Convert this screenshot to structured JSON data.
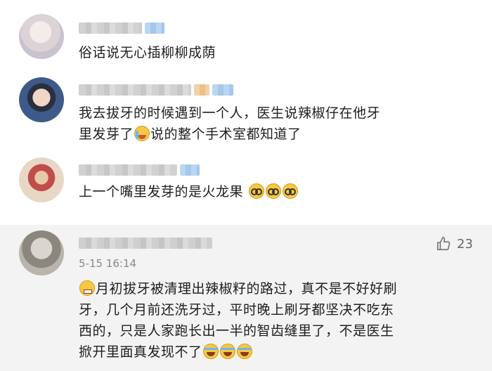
{
  "comments": [
    {
      "text": "俗话说无心插柳柳成荫"
    },
    {
      "text_line1": "我去拔牙的时候遇到一个人，医生说辣椒仔在他牙",
      "text_line2_a": "里发芽了",
      "text_line2_b": "说的整个手术室都知道了"
    },
    {
      "text": "上一个嘴里发芽的是火龙果"
    },
    {
      "timestamp": "5-15 16:14",
      "likes": "23",
      "line1": "月初拔牙被清理出辣椒籽的路过，真不是不好好刷",
      "line2": "牙，几个月前还洗牙过，平时晚上刷牙都坚决不吃东",
      "line3": "西的，只是人家跑长出一半的智齿缝里了，不是医生",
      "line4": "掀开里面真发现不了"
    }
  ],
  "icons": {
    "glasses_emoji": "glasses-emoji",
    "cry_emoji": "cry-emoji",
    "laugh_emoji": "laugh-emoji",
    "grin_emoji": "grin-emoji",
    "thumb": "thumbs-up-icon"
  }
}
